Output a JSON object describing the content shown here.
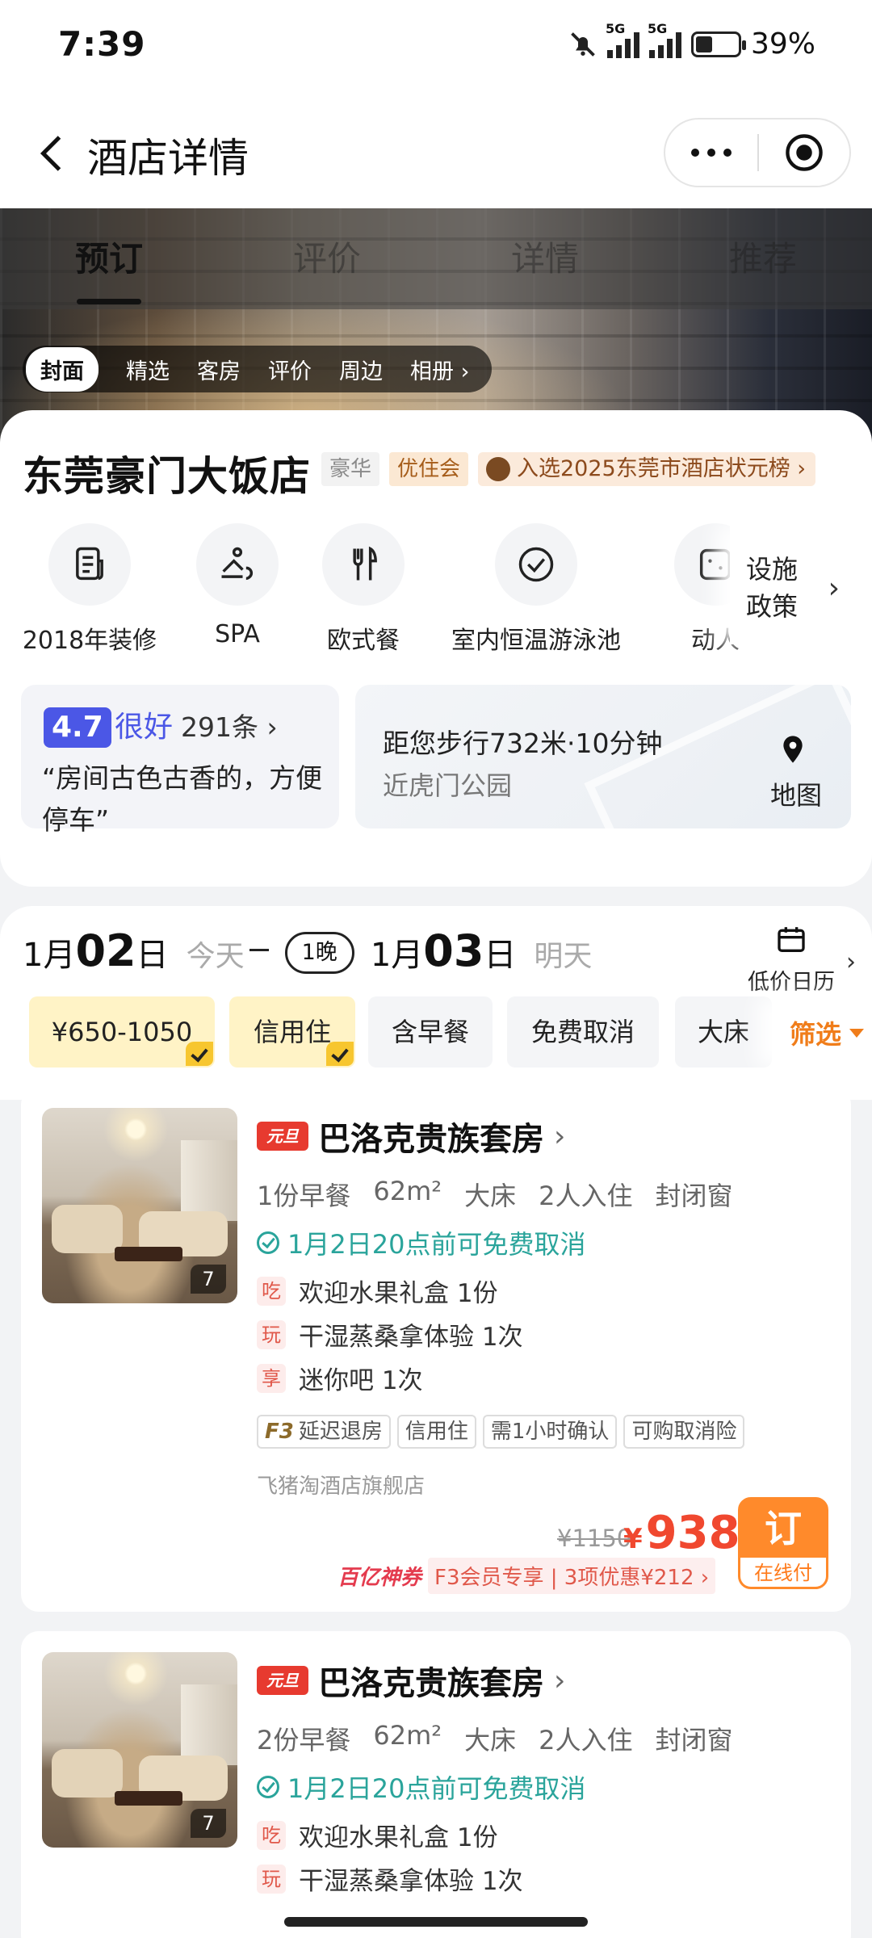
{
  "status_bar": {
    "time": "7:39",
    "signal1": "5G",
    "signal2": "5G",
    "battery": "39%",
    "battery_level": 0.39
  },
  "nav": {
    "title": "酒店详情"
  },
  "hero": {
    "tabs": [
      "预订",
      "评价",
      "详情",
      "推荐"
    ],
    "pills": [
      "封面",
      "精选",
      "客房",
      "评价",
      "周边",
      "相册 ›"
    ]
  },
  "hotel": {
    "name": "东莞豪门大饭店",
    "tag_lux": "豪华",
    "tag_member": "优住会",
    "tag_rank": "入选2025东莞市酒店状元榜 ›",
    "facilities": [
      {
        "icon": "document-icon",
        "label": "2018年装修"
      },
      {
        "icon": "spa-icon",
        "label": "SPA"
      },
      {
        "icon": "cutlery-icon",
        "label": "欧式餐"
      },
      {
        "icon": "check-circle-icon",
        "label": "室内恒温游泳池"
      },
      {
        "icon": "sparkle-icon",
        "label": "动人"
      }
    ],
    "facilities_more": [
      "设施",
      "政策"
    ],
    "rating": {
      "score": "4.7",
      "level": "很好",
      "count": "291条 ›",
      "quote": "“房间古色古香的，方便停车”"
    },
    "location": {
      "distance": "距您步行732米·10分钟",
      "nearby": "近虎门公园",
      "map_label": "地图"
    }
  },
  "booking": {
    "checkin_month": "1月",
    "checkin_day": "02",
    "checkin_suffix": "日",
    "checkin_hint": "今天",
    "nights": "1晚",
    "checkout_month": "1月",
    "checkout_day": "03",
    "checkout_suffix": "日",
    "checkout_hint": "明天",
    "calendar_label": "低价日历",
    "filters": [
      {
        "label": "¥650-1050",
        "selected": true
      },
      {
        "label": "信用住",
        "selected": true
      },
      {
        "label": "含早餐",
        "selected": false
      },
      {
        "label": "免费取消",
        "selected": false
      },
      {
        "label": "大床",
        "selected": false
      }
    ],
    "filter_button": "筛选"
  },
  "rooms": [
    {
      "tag": "元旦",
      "name": "巴洛克贵族套房",
      "photo_count": "7",
      "specs": [
        "1份早餐",
        "62m²",
        "大床",
        "2人入住",
        "封闭窗"
      ],
      "cancel": "1月2日20点前可免费取消",
      "perks": [
        {
          "k": "吃",
          "text": "欢迎水果礼盒 1份"
        },
        {
          "k": "玩",
          "text": "干湿蒸桑拿体验 1次"
        },
        {
          "k": "享",
          "text": "迷你吧 1次"
        }
      ],
      "badges": [
        "延迟退房",
        "信用住",
        "需1小时确认",
        "可购取消险"
      ],
      "f3": "F3",
      "shop": "飞猪淘酒店旗舰店",
      "old_price": "¥1150",
      "currency": "¥",
      "price": "938",
      "promo_title": "百亿神券",
      "promo_detail": "F3会员专享 | 3项优惠¥212 ›",
      "order_label": "订",
      "order_sub": "在线付"
    },
    {
      "tag": "元旦",
      "name": "巴洛克贵族套房",
      "photo_count": "7",
      "specs": [
        "2份早餐",
        "62m²",
        "大床",
        "2人入住",
        "封闭窗"
      ],
      "cancel": "1月2日20点前可免费取消",
      "perks": [
        {
          "k": "吃",
          "text": "欢迎水果礼盒 1份"
        },
        {
          "k": "玩",
          "text": "干湿蒸桑拿体验 1次"
        }
      ]
    }
  ]
}
